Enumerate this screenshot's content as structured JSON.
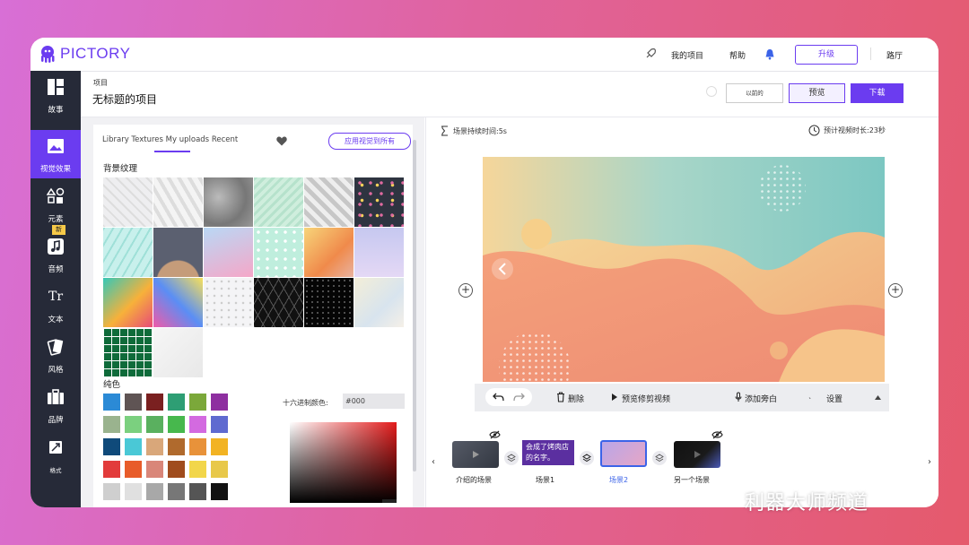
{
  "app": {
    "logo_text": "PICTORY",
    "brand_color": "#6b3cf0"
  },
  "topbar": {
    "my_projects": "我的项目",
    "help": "帮助",
    "upgrade": "升级",
    "user": "路厅"
  },
  "sidebar": {
    "items": [
      {
        "label": "故事",
        "icon": "story-layout-icon"
      },
      {
        "label": "视觉效果",
        "icon": "image-icon",
        "active": true
      },
      {
        "label": "元素",
        "icon": "elements-shapes-icon"
      },
      {
        "label": "音频",
        "icon": "music-note-icon",
        "badge": "新"
      },
      {
        "label": "文本",
        "icon": "text-icon",
        "glyph": "Tr"
      },
      {
        "label": "风格",
        "icon": "style-cards-icon"
      },
      {
        "label": "品牌",
        "icon": "briefcase-icon"
      },
      {
        "label": "格式",
        "icon": "format-resize-icon"
      }
    ]
  },
  "header": {
    "breadcrumb": "项目",
    "title": "无标题的项目",
    "previous_label": "以前的",
    "preview_label": "预览",
    "download_label": "下载"
  },
  "visuals_panel": {
    "tabs": "Library Textures My uploads Recent",
    "apply_all": "应用视觉到所有",
    "textures_title": "背景纹理",
    "solid_title": "纯色",
    "hex_label": "十六进制颜色:",
    "hex_value": "#000",
    "swatches": [
      "#2b8ad6",
      "#5f5454",
      "#7a2020",
      "#2e9e74",
      "#7ba83a",
      "#8e2fa0",
      "#9ab38e",
      "#7bd07f",
      "#5ab05f",
      "#47b84d",
      "#d36ae0",
      "#5f6ad0",
      "#0f4a7a",
      "#4ac8d6",
      "#d9a77a",
      "#b06a2d",
      "#e8923a",
      "#f2b323",
      "#e23b3b",
      "#e85c2a",
      "#d98679",
      "#a04c1d",
      "#f2d64a",
      "#e8c84a",
      "#cfcfcf",
      "#e0e0e0",
      "#a8a8a8",
      "#777",
      "#555",
      "#111"
    ]
  },
  "editor": {
    "scene_duration": "场景持续时间:5s",
    "estimated_length": "预计视频时长:23秒",
    "toolbar": {
      "delete": "删除",
      "preview_trim": "预览修剪视频",
      "add_voiceover": "添加旁白",
      "settings": "设置"
    }
  },
  "timeline": {
    "scenes": [
      {
        "label": "介绍的场景"
      },
      {
        "label": "场景1"
      },
      {
        "label": "场景2",
        "selected": true
      },
      {
        "label": "另一个场景"
      }
    ],
    "callout_text": "会成了烤肉店的名字。"
  },
  "watermark": "利器大师频道"
}
